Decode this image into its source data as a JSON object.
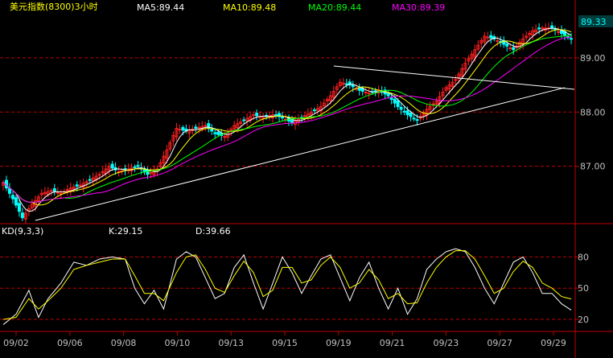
{
  "title": "美元指数(8300)3小时",
  "ma_labels": [
    {
      "text": "MA5:89.44",
      "color": "#ffffff"
    },
    {
      "text": "MA10:89.48",
      "color": "#ffff00"
    },
    {
      "text": "MA20:89.44",
      "color": "#00ff00"
    },
    {
      "text": "MA30:89.39",
      "color": "#ff00ff"
    }
  ],
  "last_price": "89.33",
  "kd_labels": [
    {
      "text": "KD(9,3,3)",
      "color": "#ffffff"
    },
    {
      "text": "K:29.15",
      "color": "#ffffff"
    },
    {
      "text": "D:39.66",
      "color": "#ffffff"
    }
  ],
  "colors": {
    "up": "#ff2020",
    "down": "#00ffff",
    "grid": "#c00000",
    "axis": "#c00000",
    "axis_text": "#c0c0c0",
    "trendline": "#ffffff",
    "badge_bg": "#003c3c",
    "badge_fg": "#00ffff"
  },
  "chart_data": [
    {
      "type": "candlestick",
      "title": "美元指数(8300)3小时",
      "x_ticks": [
        "09/02",
        "09/06",
        "09/08",
        "09/10",
        "09/13",
        "09/15",
        "09/19",
        "09/21",
        "09/23",
        "09/27",
        "09/29"
      ],
      "y_ticks": [
        "89.00",
        "88.00",
        "87.00"
      ],
      "ylim": [
        86.0,
        89.8
      ],
      "close_anchors": [
        [
          0,
          86.7
        ],
        [
          3,
          86.4
        ],
        [
          6,
          86.05
        ],
        [
          9,
          86.3
        ],
        [
          12,
          86.5
        ],
        [
          15,
          86.55
        ],
        [
          18,
          86.5
        ],
        [
          21,
          86.6
        ],
        [
          24,
          86.65
        ],
        [
          27,
          86.75
        ],
        [
          30,
          86.85
        ],
        [
          33,
          87.0
        ],
        [
          36,
          86.9
        ],
        [
          39,
          86.95
        ],
        [
          42,
          87.0
        ],
        [
          45,
          86.85
        ],
        [
          48,
          86.95
        ],
        [
          51,
          87.3
        ],
        [
          54,
          87.7
        ],
        [
          57,
          87.65
        ],
        [
          60,
          87.7
        ],
        [
          63,
          87.75
        ],
        [
          66,
          87.6
        ],
        [
          69,
          87.55
        ],
        [
          72,
          87.75
        ],
        [
          75,
          87.85
        ],
        [
          78,
          87.95
        ],
        [
          81,
          87.9
        ],
        [
          84,
          87.95
        ],
        [
          87,
          87.9
        ],
        [
          90,
          87.8
        ],
        [
          93,
          87.9
        ],
        [
          96,
          88.0
        ],
        [
          99,
          88.1
        ],
        [
          102,
          88.3
        ],
        [
          105,
          88.55
        ],
        [
          108,
          88.5
        ],
        [
          111,
          88.4
        ],
        [
          114,
          88.35
        ],
        [
          117,
          88.4
        ],
        [
          120,
          88.3
        ],
        [
          123,
          88.1
        ],
        [
          126,
          87.95
        ],
        [
          129,
          87.85
        ],
        [
          132,
          88.05
        ],
        [
          135,
          88.2
        ],
        [
          138,
          88.45
        ],
        [
          141,
          88.6
        ],
        [
          144,
          88.9
        ],
        [
          147,
          89.15
        ],
        [
          150,
          89.4
        ],
        [
          153,
          89.35
        ],
        [
          156,
          89.25
        ],
        [
          159,
          89.15
        ],
        [
          162,
          89.35
        ],
        [
          165,
          89.5
        ],
        [
          168,
          89.55
        ],
        [
          171,
          89.55
        ],
        [
          174,
          89.45
        ],
        [
          177,
          89.35
        ]
      ],
      "moving_averages": [
        {
          "name": "MA5",
          "value": 89.44,
          "period": 5
        },
        {
          "name": "MA10",
          "value": 89.48,
          "period": 10
        },
        {
          "name": "MA20",
          "value": 89.44,
          "period": 20
        },
        {
          "name": "MA30",
          "value": 89.39,
          "period": 30
        }
      ],
      "last_price": 89.33,
      "trendlines": [
        {
          "from": [
            10,
            86.0
          ],
          "to": [
            175,
            88.45
          ]
        },
        {
          "from": [
            103,
            88.85
          ],
          "to": [
            178,
            88.42
          ]
        }
      ]
    },
    {
      "type": "line",
      "title": "KD(9,3,3)",
      "ylim": [
        10,
        95
      ],
      "y_ticks": [
        80,
        50,
        20
      ],
      "series": [
        {
          "name": "K",
          "last": 29.15,
          "anchors": [
            [
              0,
              15
            ],
            [
              4,
              25
            ],
            [
              8,
              48
            ],
            [
              11,
              22
            ],
            [
              14,
              40
            ],
            [
              18,
              55
            ],
            [
              22,
              75
            ],
            [
              26,
              72
            ],
            [
              30,
              78
            ],
            [
              34,
              80
            ],
            [
              38,
              78
            ],
            [
              41,
              50
            ],
            [
              44,
              35
            ],
            [
              47,
              48
            ],
            [
              50,
              30
            ],
            [
              54,
              78
            ],
            [
              57,
              85
            ],
            [
              60,
              80
            ],
            [
              63,
              60
            ],
            [
              66,
              40
            ],
            [
              69,
              45
            ],
            [
              72,
              70
            ],
            [
              75,
              82
            ],
            [
              78,
              55
            ],
            [
              81,
              30
            ],
            [
              84,
              55
            ],
            [
              87,
              80
            ],
            [
              90,
              65
            ],
            [
              93,
              45
            ],
            [
              96,
              62
            ],
            [
              99,
              78
            ],
            [
              102,
              82
            ],
            [
              105,
              60
            ],
            [
              108,
              38
            ],
            [
              111,
              60
            ],
            [
              114,
              75
            ],
            [
              117,
              50
            ],
            [
              120,
              30
            ],
            [
              123,
              50
            ],
            [
              126,
              25
            ],
            [
              129,
              40
            ],
            [
              132,
              68
            ],
            [
              135,
              78
            ],
            [
              138,
              85
            ],
            [
              141,
              88
            ],
            [
              144,
              85
            ],
            [
              147,
              70
            ],
            [
              150,
              50
            ],
            [
              153,
              35
            ],
            [
              156,
              55
            ],
            [
              159,
              75
            ],
            [
              162,
              80
            ],
            [
              165,
              65
            ],
            [
              168,
              45
            ],
            [
              171,
              45
            ],
            [
              174,
              35
            ],
            [
              177,
              29
            ]
          ]
        },
        {
          "name": "D",
          "last": 39.66,
          "anchors": [
            [
              0,
              20
            ],
            [
              4,
              22
            ],
            [
              8,
              40
            ],
            [
              11,
              30
            ],
            [
              14,
              38
            ],
            [
              18,
              50
            ],
            [
              22,
              68
            ],
            [
              26,
              72
            ],
            [
              30,
              75
            ],
            [
              34,
              78
            ],
            [
              38,
              78
            ],
            [
              41,
              62
            ],
            [
              44,
              45
            ],
            [
              47,
              45
            ],
            [
              50,
              38
            ],
            [
              54,
              65
            ],
            [
              57,
              80
            ],
            [
              60,
              82
            ],
            [
              63,
              68
            ],
            [
              66,
              50
            ],
            [
              69,
              46
            ],
            [
              72,
              62
            ],
            [
              75,
              76
            ],
            [
              78,
              65
            ],
            [
              81,
              42
            ],
            [
              84,
              48
            ],
            [
              87,
              70
            ],
            [
              90,
              70
            ],
            [
              93,
              55
            ],
            [
              96,
              58
            ],
            [
              99,
              72
            ],
            [
              102,
              80
            ],
            [
              105,
              70
            ],
            [
              108,
              50
            ],
            [
              111,
              55
            ],
            [
              114,
              68
            ],
            [
              117,
              58
            ],
            [
              120,
              40
            ],
            [
              123,
              45
            ],
            [
              126,
              35
            ],
            [
              129,
              36
            ],
            [
              132,
              55
            ],
            [
              135,
              70
            ],
            [
              138,
              80
            ],
            [
              141,
              86
            ],
            [
              144,
              86
            ],
            [
              147,
              78
            ],
            [
              150,
              62
            ],
            [
              153,
              45
            ],
            [
              156,
              50
            ],
            [
              159,
              66
            ],
            [
              162,
              76
            ],
            [
              165,
              70
            ],
            [
              168,
              55
            ],
            [
              171,
              50
            ],
            [
              174,
              42
            ],
            [
              177,
              39.66
            ]
          ]
        }
      ]
    }
  ]
}
